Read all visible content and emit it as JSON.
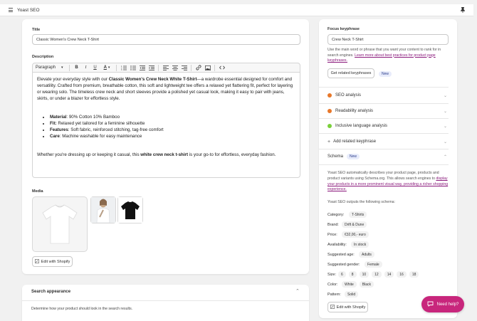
{
  "app": {
    "title": "Yoast SEO"
  },
  "product": {
    "title_label": "Title",
    "title_value": "Classic Women's Crew Neck T-Shirt",
    "description_label": "Description",
    "paragraph_select": "Paragraph",
    "media_label": "Media",
    "edit_with_shopify": "Edit with Shopify"
  },
  "description": {
    "p1_a": "Elevate your everyday style with our ",
    "p1_b": "Classic Women's Crew Neck White T-Shirt",
    "p1_c": "—a wardrobe essential designed for comfort and versatility. Crafted from premium, breathable cotton, this soft and lightweight tee offers a relaxed yet flattering fit, perfect for layering or wearing solo. The timeless crew neck and short sleeves provide a polished yet casual look, making it easy to pair with jeans, skirts, or under a blazer for effortless style.",
    "li1_k": "Material",
    "li1_v": ": 90% Cotton 10% Bamboo",
    "li2_k": "Fit:",
    "li2_v": " Relaxed yet tailored for a feminine silhouette",
    "li3_k": "Features",
    "li3_v": ": Soft fabric, reinforced stitching, tag-free comfort",
    "li4_k": "Care",
    "li4_v": ": Machine washable for easy maintenance",
    "p2_a": "Whether you're dressing up or keeping it casual, this ",
    "p2_b": "white crew neck t-shirt",
    "p2_c": " is your go-to for effortless, everyday fashion."
  },
  "search_appearance": {
    "title": "Search appearance",
    "desc": "Determine how your product should look in the search results."
  },
  "seo": {
    "focus_label": "Focus keyphrase",
    "focus_value": "Crew Neck T-Shirt",
    "help_text": "Use the main word or phrase that you want your content to rank for in search engines. ",
    "help_link": "Learn more about best practices for product page keyphrases.",
    "related_button": "Get related keyphrases",
    "new_badge": "New",
    "seo_analysis": "SEO analysis",
    "readability": "Readability analysis",
    "inclusive": "Inclusive language analysis",
    "add_related": "Add related keyphrase",
    "schema": "Schema",
    "schema_badge": "New",
    "schema_desc": "Yoast SEO automatically describes your product page, products and product variants using Schema.org. This allows search engines to ",
    "schema_link": "display your products in a more prominent visual way, providing a richer shopping experience.",
    "schema_outputs": "Yoast SEO outputs the following schema:",
    "category_label": "Category:",
    "category": "T-Shirts",
    "brand_label": "Brand:",
    "brand": "Drift & Dune",
    "price_label": "Price:",
    "price": "€32,00,- euro",
    "availability_label": "Availability:",
    "availability": "In stock",
    "age_label": "Suggested age:",
    "age": "Adults",
    "gender_label": "Suggested gender:",
    "gender": "Female",
    "size_label": "Size:",
    "sizes": [
      "6",
      "8",
      "10",
      "12",
      "14",
      "16",
      "18"
    ],
    "color_label": "Color:",
    "colors": [
      "White",
      "Black"
    ],
    "pattern_label": "Pattern:",
    "pattern": "Solid",
    "edit_with_shopify": "Edit with Shopify"
  },
  "help_button": "Need help?",
  "colors": {
    "seo_dot": "#e8782a",
    "readability_dot": "#e8782a",
    "inclusive_dot": "#7ad03a",
    "help_bg": "#c8267c"
  }
}
